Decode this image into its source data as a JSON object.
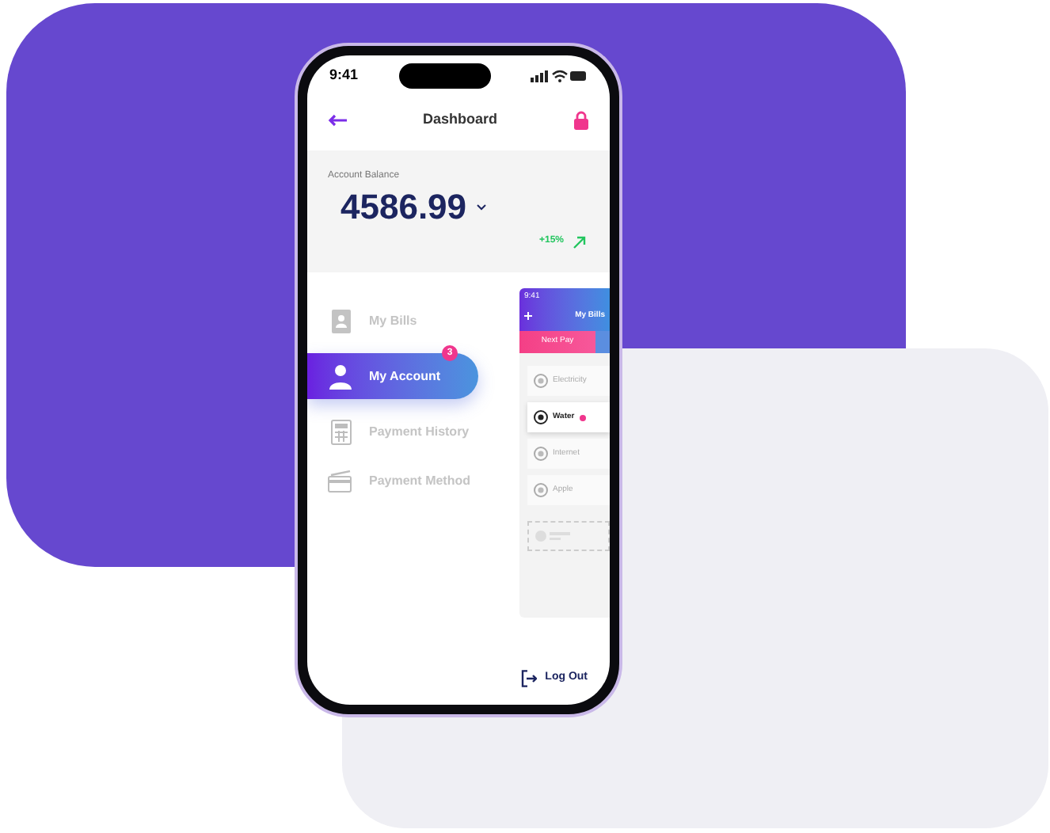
{
  "status_bar": {
    "time": "9:41"
  },
  "header": {
    "title": "Dashboard"
  },
  "balance": {
    "label": "Account Balance",
    "amount": "4586.99",
    "change": "+15%"
  },
  "menu": [
    {
      "label": "My Bills",
      "selected": false
    },
    {
      "label": "My Account",
      "selected": true,
      "badge": "3"
    },
    {
      "label": "Payment History",
      "selected": false
    },
    {
      "label": "Payment Method",
      "selected": false
    }
  ],
  "preview": {
    "time": "9:41",
    "title": "My Bills",
    "tab": "Next Pay",
    "bills": [
      {
        "name": "Electricity",
        "selected": false
      },
      {
        "name": "Water",
        "selected": true
      },
      {
        "name": "Internet",
        "selected": false
      },
      {
        "name": "Apple",
        "selected": false
      }
    ]
  },
  "logout": "Log Out"
}
